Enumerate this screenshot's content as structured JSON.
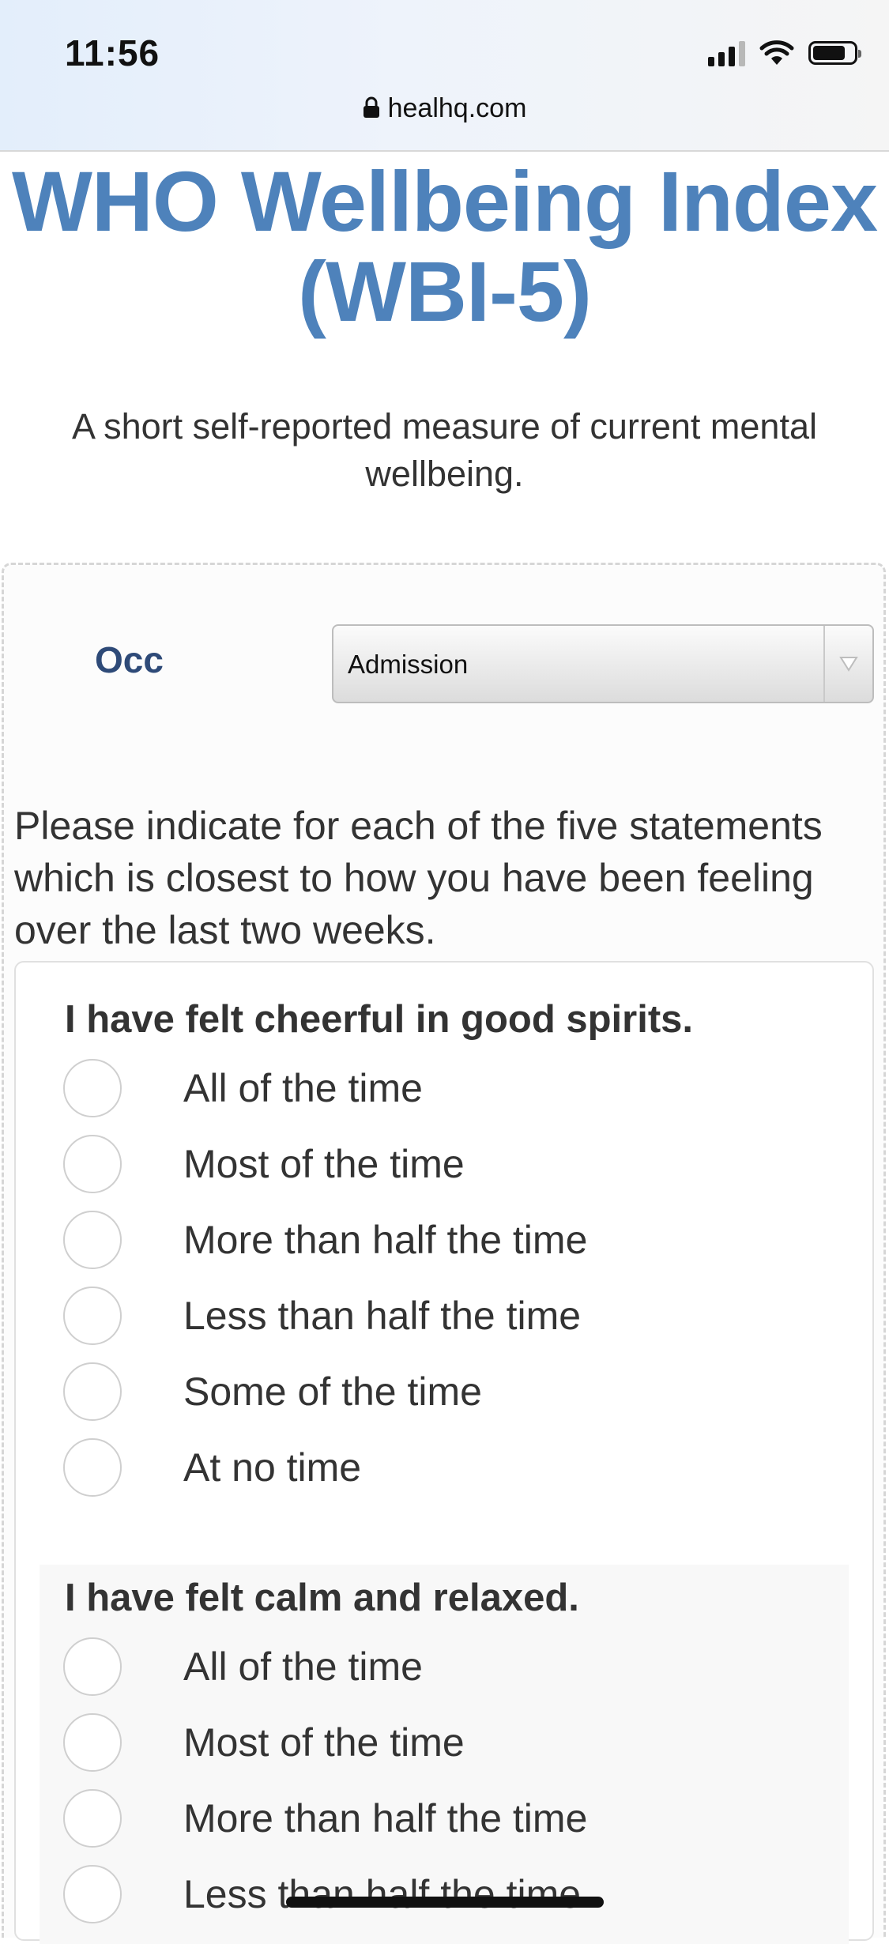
{
  "status_bar": {
    "time": "11:56",
    "icons": [
      "signal-icon",
      "wifi-icon",
      "battery-icon"
    ]
  },
  "browser": {
    "url": "healhq.com",
    "lock_icon": "lock-icon"
  },
  "page": {
    "title": "WHO Wellbeing Index (WBI-5)",
    "subtitle": "A short self-reported measure of current mental wellbeing.",
    "title_color": "#4e82bb"
  },
  "form": {
    "occ_label": "Occ",
    "occ_selected": "Admission",
    "instructions": "Please indicate for each of the five statements which is closest to how you have been feeling over the last two weeks.",
    "questions": [
      {
        "text": "I have felt cheerful in good spirits.",
        "options": [
          "All of the time",
          "Most of the time",
          "More than half the time",
          "Less than half the time",
          "Some of the time",
          "At no time"
        ]
      },
      {
        "text": "I have felt calm and relaxed.",
        "options": [
          "All of the time",
          "Most of the time",
          "More than half the time",
          "Less than half the time"
        ]
      }
    ]
  }
}
